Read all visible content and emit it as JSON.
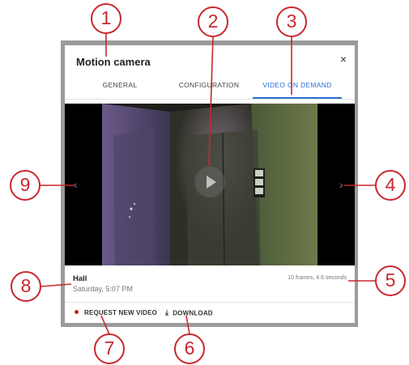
{
  "dialog": {
    "title": "Motion camera",
    "close_glyph": "×",
    "tabs": [
      {
        "label": "GENERAL",
        "active": false
      },
      {
        "label": "CONFIGURATION",
        "active": false
      },
      {
        "label": "VIDEO ON DEMAND",
        "active": true
      }
    ],
    "accent_color": "#2a6fd6"
  },
  "video": {
    "prev_arrow": "‹",
    "next_arrow": "›",
    "play_icon": "play-icon"
  },
  "info": {
    "location": "Hall",
    "timestamp": "Saturday, 5:07 PM",
    "frames": "10 frames, 4.6 seconds"
  },
  "actions": {
    "request_label": "REQUEST NEW VIDEO",
    "download_label": "DOWNLOAD",
    "record_dot_color": "#d0202a"
  },
  "callouts": {
    "color": "#c8282e",
    "numbers": [
      "1",
      "2",
      "3",
      "4",
      "5",
      "6",
      "7",
      "8",
      "9"
    ]
  }
}
